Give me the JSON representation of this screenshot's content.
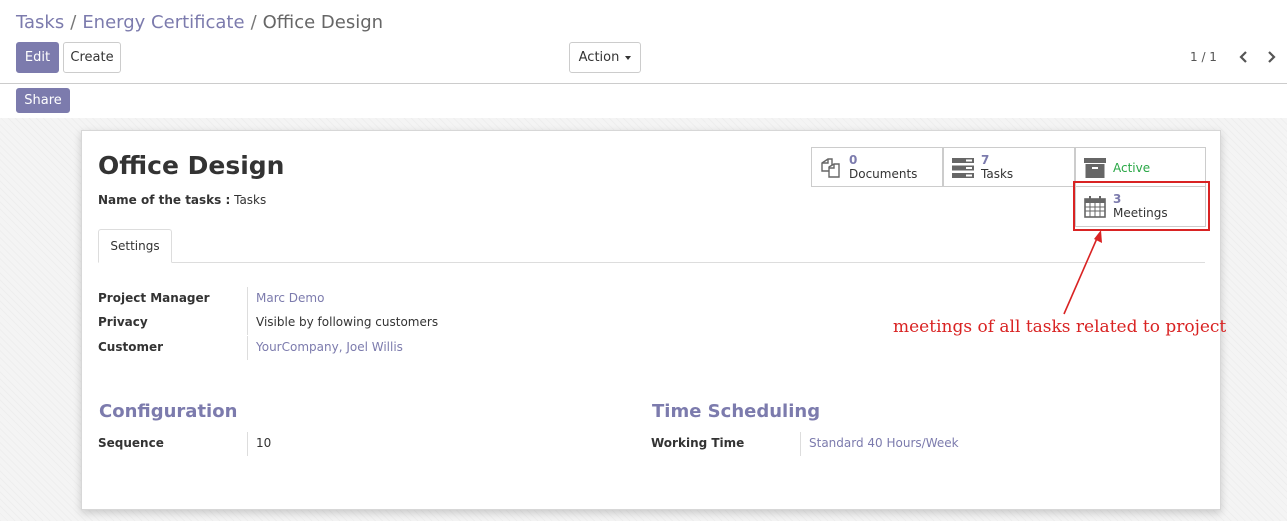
{
  "breadcrumb": {
    "items": [
      "Tasks",
      "Energy Certificate"
    ],
    "active": "Office Design",
    "separator": "/"
  },
  "toolbar": {
    "edit_label": "Edit",
    "create_label": "Create",
    "action_label": "Action",
    "share_label": "Share"
  },
  "pager": {
    "value": "1 / 1"
  },
  "record": {
    "title": "Office Design",
    "subtitle_label": "Name of the tasks :",
    "subtitle_value": "Tasks"
  },
  "smart_buttons": {
    "documents": {
      "count": "0",
      "label": "Documents",
      "icon": "documents-icon"
    },
    "tasks": {
      "count": "7",
      "label": "Tasks",
      "icon": "tasks-icon"
    },
    "active": {
      "label": "Active",
      "icon": "archive-icon"
    },
    "meetings": {
      "count": "3",
      "label": "Meetings",
      "icon": "calendar-icon"
    }
  },
  "tabs": [
    {
      "label": "Settings"
    }
  ],
  "fields": {
    "project_manager": {
      "label": "Project Manager",
      "value": "Marc Demo"
    },
    "privacy": {
      "label": "Privacy",
      "value": "Visible by following customers"
    },
    "customer": {
      "label": "Customer",
      "value": "YourCompany, Joel Willis"
    },
    "sequence": {
      "label": "Sequence",
      "value": "10"
    },
    "working_time": {
      "label": "Working Time",
      "value": "Standard 40 Hours/Week"
    }
  },
  "sections": {
    "configuration": "Configuration",
    "time_scheduling": "Time Scheduling"
  },
  "annotation": {
    "text": "meetings of all tasks related to project"
  },
  "colors": {
    "brand": "#7c7bad",
    "active_green": "#28a745",
    "annotation_red": "#d92323"
  }
}
